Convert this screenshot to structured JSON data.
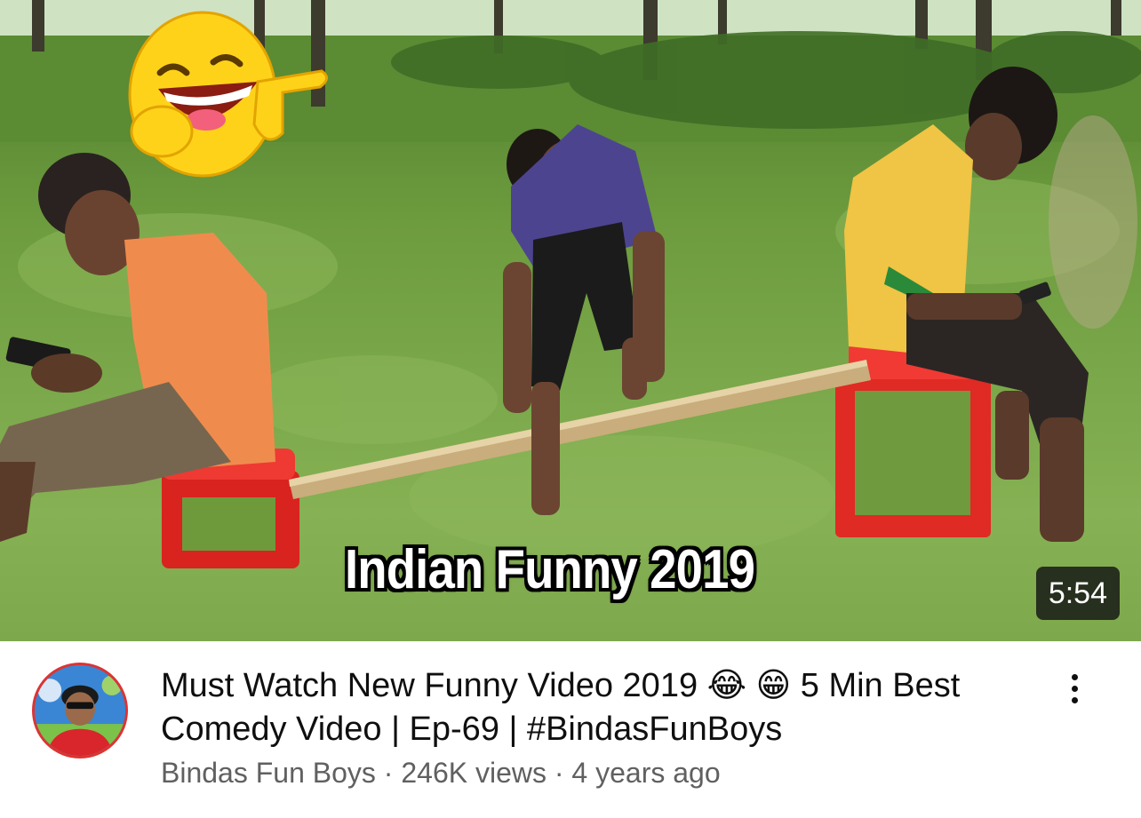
{
  "thumbnail": {
    "caption": "Indian Funny 2019",
    "duration": "5:54"
  },
  "video": {
    "title": "Must Watch New Funny Video 2019 😂 😁 5 Min Best Comedy Video | Ep-69 | #BindasFunBoys",
    "channel": "Bindas Fun Boys",
    "views": "246K views",
    "age": "4 years ago",
    "separator": " · "
  },
  "icons": {
    "emoji_sticker": "laughing-pointing-emoji",
    "more": "more-vertical-icon"
  }
}
